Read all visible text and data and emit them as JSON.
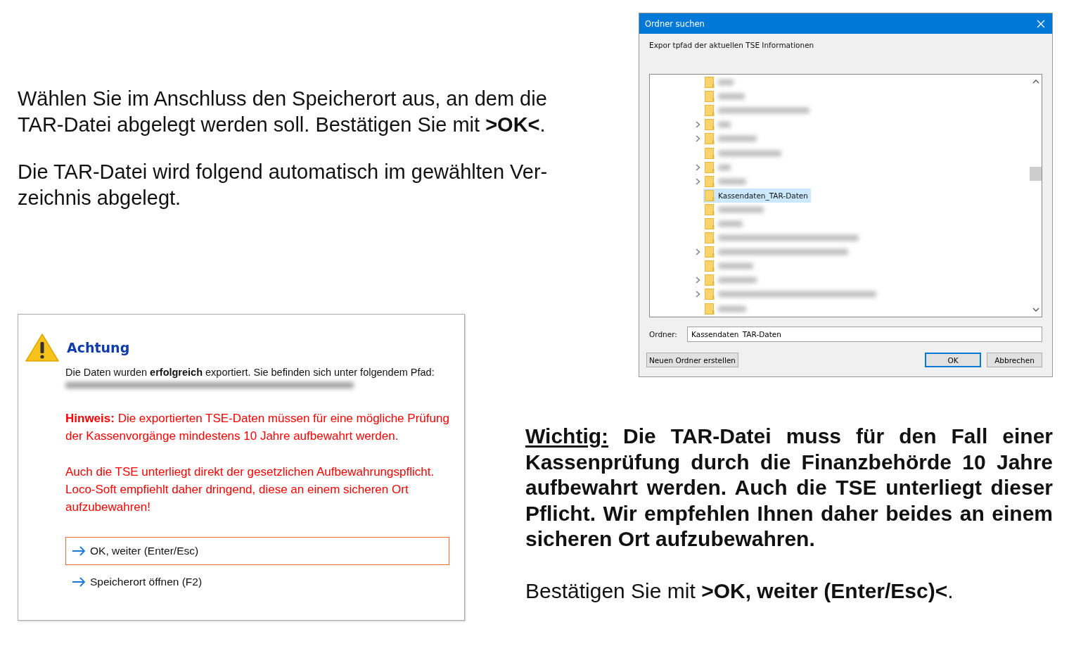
{
  "intro": [
    "Wählen Sie im Anschluss den Speicherort aus, an dem die TAR-Datei abgelegt werden soll. Bestätigen Sie mit **>OK<**.",
    "Die TAR-Datei wird folgend automatisch im gewählten Ver-zeichnis abgelegt."
  ],
  "folder_dialog": {
    "title": "Ordner suchen",
    "description": "Expor tpfad der aktuellen TSE Informationen",
    "tree": [
      {
        "expandable": false,
        "selected": false
      },
      {
        "expandable": false,
        "selected": false
      },
      {
        "expandable": false,
        "selected": false
      },
      {
        "expandable": true,
        "selected": false
      },
      {
        "expandable": true,
        "selected": false
      },
      {
        "expandable": false,
        "selected": false
      },
      {
        "expandable": true,
        "selected": false
      },
      {
        "expandable": true,
        "selected": false
      },
      {
        "expandable": false,
        "selected": true,
        "label": "Kassendaten_TAR-Daten"
      },
      {
        "expandable": false,
        "selected": false
      },
      {
        "expandable": false,
        "selected": false
      },
      {
        "expandable": false,
        "selected": false
      },
      {
        "expandable": true,
        "selected": false
      },
      {
        "expandable": false,
        "selected": false
      },
      {
        "expandable": true,
        "selected": false
      },
      {
        "expandable": true,
        "selected": false
      },
      {
        "expandable": false,
        "selected": false
      }
    ],
    "folder_label": "Ordner:",
    "folder_value": "Kassendaten_TAR-Daten",
    "buttons": [
      {
        "label": "Neuen Ordner erstellen",
        "default": false
      },
      {
        "label": "OK",
        "default": true
      },
      {
        "label": "Abbrechen",
        "default": false
      }
    ]
  },
  "alert_dialog": {
    "title": "Achtung",
    "message": "Die Daten wurden **erfolgreich** exportiert. Sie befinden sich unter folgendem Pfad:",
    "notes": [
      "**Hinweis:** Die exportierten TSE-Daten müssen für eine mögliche Prüfung der Kassenvorgänge mindestens 10 Jahre aufbewahrt werden.",
      "Auch die TSE unterliegt direkt der gesetzlichen Aufbewahrungspflicht. Loco-Soft empfiehlt daher dringend, diese an einem sicheren Ort aufzubewahren!"
    ],
    "options": [
      {
        "label": "OK, weiter (Enter/Esc)",
        "selected": true
      },
      {
        "label": "Speicherort öffnen (F2)",
        "selected": false
      }
    ]
  },
  "important": {
    "lead": "Wichtig:",
    "text": "Die TAR-Datei muss für den Fall einer Kassenprüfung durch die Finanzbehörde 10 Jahre aufbewahrt werden. Auch die TSE unterliegt dieser Pflicht. Wir empfehlen Ihnen daher beides an einem sicheren Ort aufzubewahren."
  },
  "confirm": "Bestätigen Sie mit **>OK, weiter (Enter/Esc)<**."
}
